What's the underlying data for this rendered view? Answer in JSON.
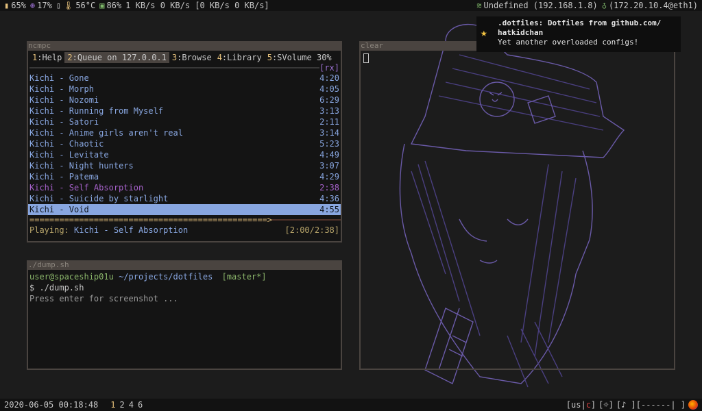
{
  "topbar": {
    "battery": "65%",
    "cpu": "17%",
    "temp": "56°C",
    "memory": "86%",
    "net_speed": "1 KB/s 0 KB/s [0 KB/s 0 KB/s]",
    "wifi": "Undefined (192.168.1.8)",
    "eth": "(172.20.10.4@eth1)"
  },
  "notification": {
    "summary": ".dotfiles: Dotfiles from github.com/ hatkidchan",
    "body": "Yet another overloaded configs!"
  },
  "ncmpc": {
    "title": "ncmpc",
    "tabs": [
      {
        "num": "1",
        "label": ":Help"
      },
      {
        "num": "2",
        "label": ":Queue on 127.0.0.1"
      },
      {
        "num": "3",
        "label": ":Browse"
      },
      {
        "num": "4",
        "label": ":Library"
      },
      {
        "num": "5",
        "label": ":SVolume 30%"
      }
    ],
    "rx": "[rx]",
    "songs": [
      {
        "title": "Kichi - Gone",
        "time": "4:20"
      },
      {
        "title": "Kichi - Morph",
        "time": "4:05"
      },
      {
        "title": "Kichi - Nozomi",
        "time": "6:29"
      },
      {
        "title": "Kichi - Running from Myself",
        "time": "3:13"
      },
      {
        "title": "Kichi - Satori",
        "time": "2:11"
      },
      {
        "title": "Kichi - Anime girls aren't real",
        "time": "3:14"
      },
      {
        "title": "Kichi - Chaotic",
        "time": "5:23"
      },
      {
        "title": "Kichi - Levitate",
        "time": "4:49"
      },
      {
        "title": "Kichi - Night hunters",
        "time": "3:07"
      },
      {
        "title": "Kichi - Patema",
        "time": "4:29"
      },
      {
        "title": "Kichi - Self Absorption",
        "time": "2:38"
      },
      {
        "title": "Kichi - Suicide by starlight",
        "time": "4:36"
      },
      {
        "title": "Kichi - Void",
        "time": "4:55"
      }
    ],
    "progress_fraction": 0.76,
    "playing_label": "Playing:",
    "playing_song": "Kichi - Self Absorption",
    "playing_time": "[2:00/2:38]"
  },
  "clear_window": {
    "title": "clear"
  },
  "dump": {
    "title": "./dump.sh",
    "prompt_user": "user@spaceship01u",
    "prompt_path": "~/projects/dotfiles",
    "prompt_branch": "[master*]",
    "command": "$ ./dump.sh",
    "output": "Press enter for screenshot ..."
  },
  "bottombar": {
    "datetime": "2020-06-05 00:18:48",
    "workspaces": [
      "1",
      "2",
      "4",
      "6"
    ],
    "layout_prefix": "[us|",
    "layout_c": "c",
    "layout_suffix": "]",
    "brightness": "[☼]",
    "volume": "[♪ ][------|      ]"
  }
}
